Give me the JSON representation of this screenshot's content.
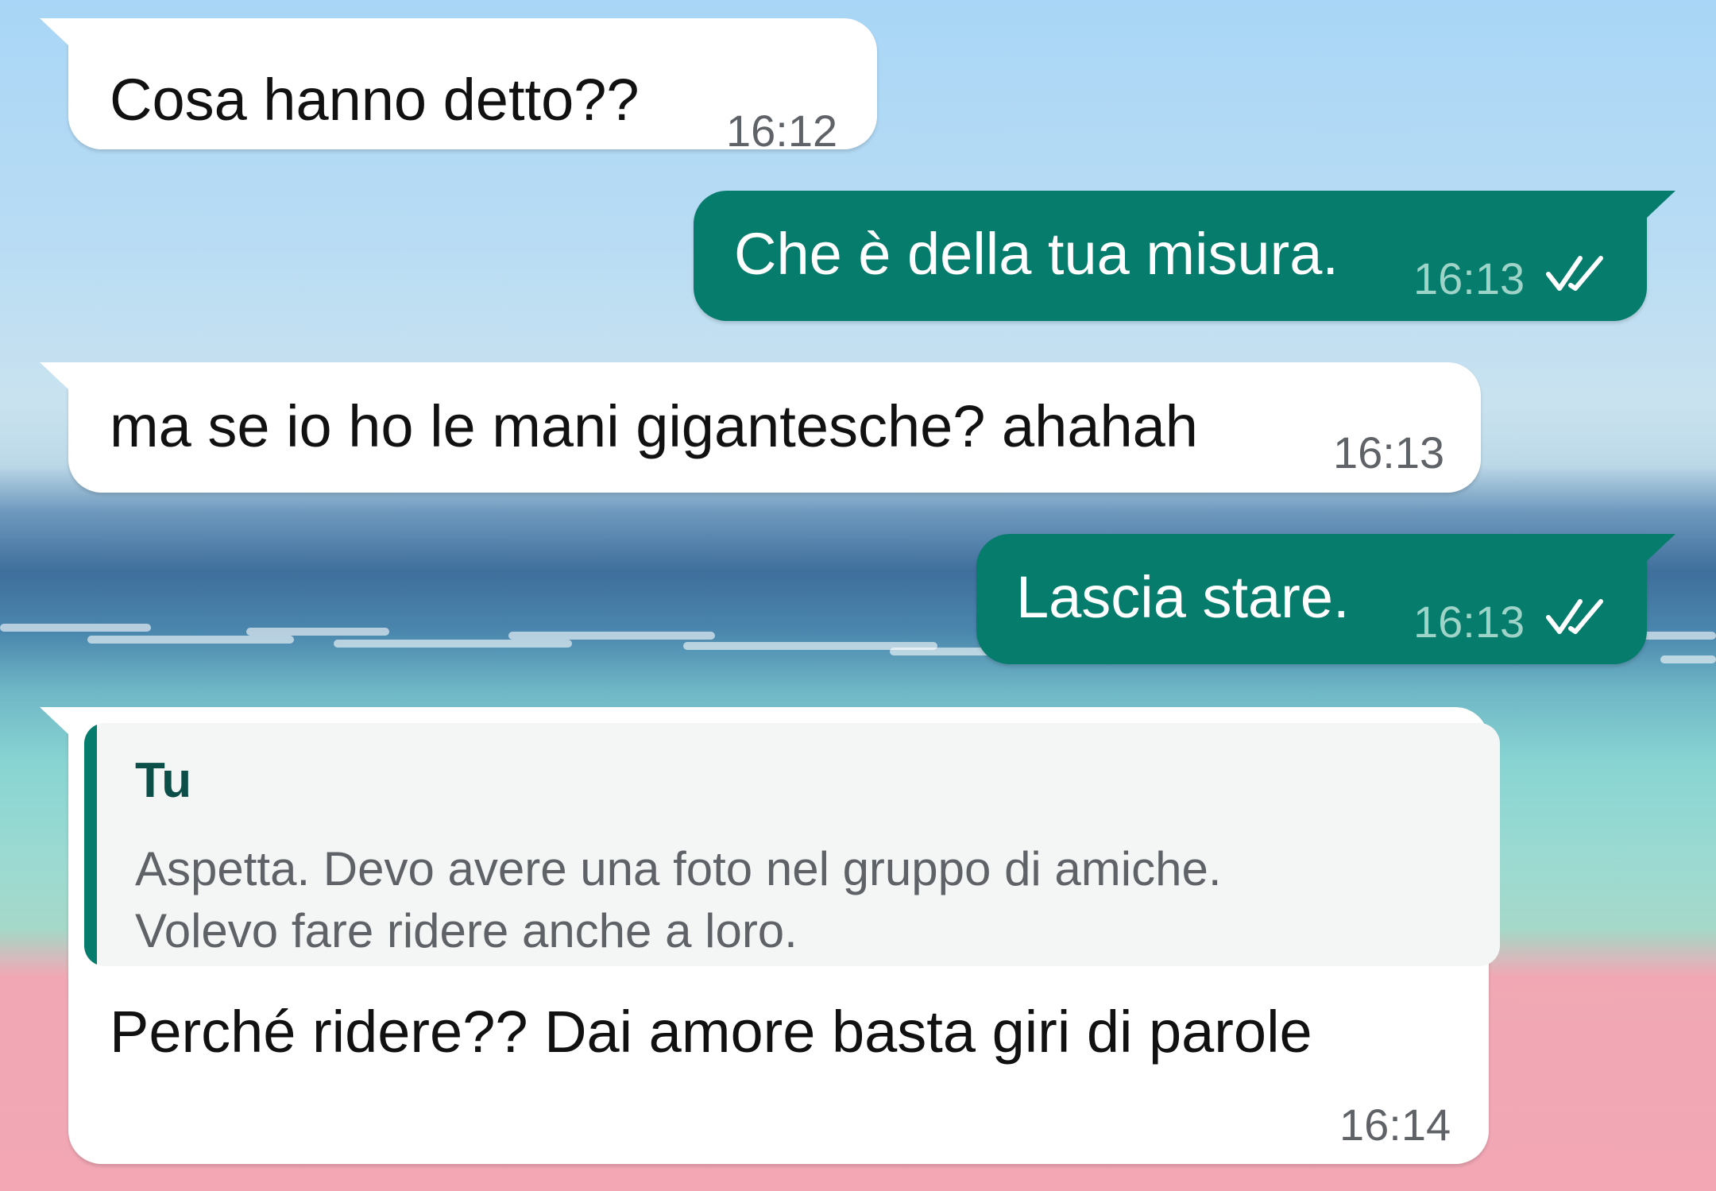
{
  "chat": {
    "messages": [
      {
        "direction": "incoming",
        "text": "Cosa hanno detto??",
        "time": "16:12"
      },
      {
        "direction": "outgoing",
        "text": "Che è della tua misura.",
        "time": "16:13",
        "status": "read"
      },
      {
        "direction": "incoming",
        "text": "ma se io ho le mani gigantesche? ahahah",
        "time": "16:13"
      },
      {
        "direction": "outgoing",
        "text": "Lascia stare.",
        "time": "16:13",
        "status": "read"
      },
      {
        "direction": "incoming",
        "quote": {
          "author": "Tu",
          "lines": [
            "Aspetta. Devo avere una foto nel gruppo di amiche.",
            "Volevo fare ridere anche a loro."
          ]
        },
        "text": "Perché ridere?? Dai amore basta giri di parole",
        "time": "16:14"
      }
    ]
  },
  "colors": {
    "outgoing_bubble": "#067c6d",
    "incoming_bubble": "#ffffff",
    "read_ticks": "#ffffff",
    "quote_accent": "#067c6d"
  },
  "icons": {
    "read_status": "double-check-icon"
  }
}
